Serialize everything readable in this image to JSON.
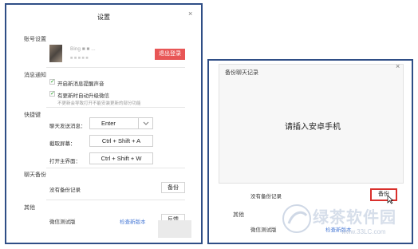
{
  "left": {
    "title": "设置",
    "close_glyph": "×",
    "account": {
      "section": "账号设置",
      "username": "Bing ■ ■ ...",
      "user_sub": "■ ■ ■ ■ ■",
      "logout": "退出登录"
    },
    "notify": {
      "section": "消息通知",
      "options": [
        {
          "label": "开启新消息提醒声音",
          "checked": true
        },
        {
          "label": "有更新时自动升级微信",
          "checked": true
        }
      ],
      "hint": "不更新会导致打开不能安装更新的部分功能"
    },
    "shortcut": {
      "section": "快捷键",
      "rows": [
        {
          "label": "聊天发送消息：",
          "value": "Enter"
        },
        {
          "label": "截取屏幕：",
          "value": "Ctrl + Shift + A"
        },
        {
          "label": "打开主界面：",
          "value": "Ctrl + Shift + W"
        }
      ],
      "dropdown_icon": "chevron-down"
    },
    "backup": {
      "section": "聊天备份",
      "empty": "没有备份记录",
      "button": "备份"
    },
    "other": {
      "section": "其他",
      "item": "微信测试版",
      "check_link": "检查新版本",
      "button": "反馈"
    }
  },
  "right": {
    "title": "备份聊天记录",
    "close_glyph": "×",
    "prompt": "请插入安卓手机",
    "empty": "没有备份记录",
    "button": "备份",
    "other_section": "其他",
    "other_item": "微信测试版",
    "check_link": "检查新版本",
    "watermark_text": "绿茶软件园",
    "watermark_url": "www.33LC.com"
  },
  "colors": {
    "frame": "#2f4e86",
    "logout_bg": "#e85656",
    "link": "#4a7bd6",
    "highlight": "#d9302c",
    "check": "#2aa52a"
  }
}
